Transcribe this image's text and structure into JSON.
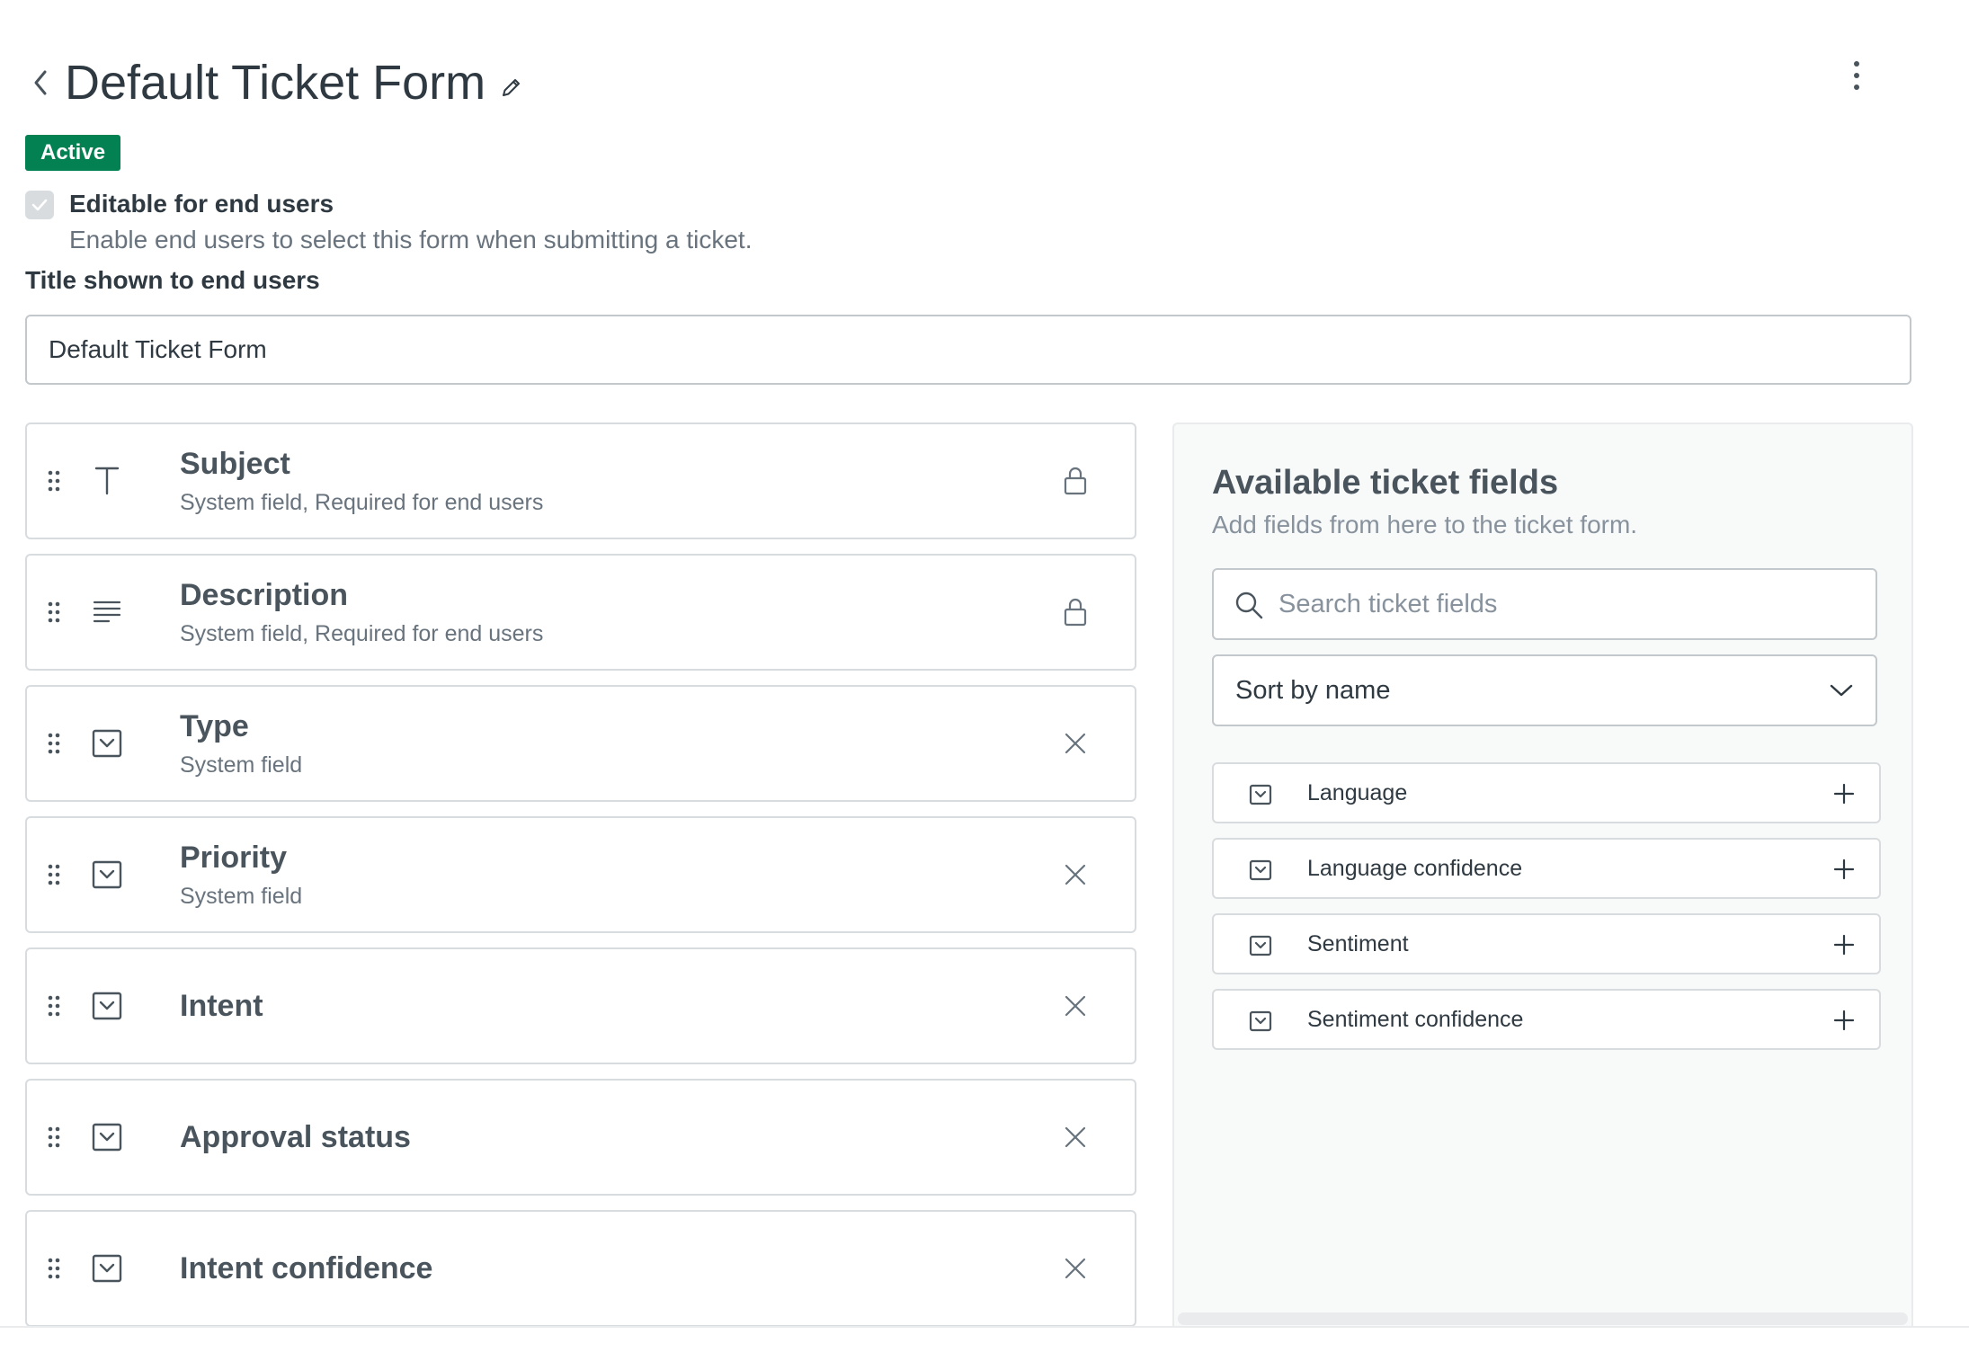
{
  "header": {
    "title": "Default Ticket Form",
    "back_icon": "chevron-left-icon",
    "edit_icon": "pencil-icon",
    "menu_icon": "kebab-menu-icon"
  },
  "status": {
    "label": "Active",
    "color": "#038153"
  },
  "editable": {
    "checked": true,
    "label": "Editable for end users",
    "hint": "Enable end users to select this form when submitting a ticket."
  },
  "title_field": {
    "label": "Title shown to end users",
    "value": "Default Ticket Form"
  },
  "form_fields": [
    {
      "name": "Subject",
      "description": "System field, Required for end users",
      "icon": "text-icon",
      "action": "lock-icon"
    },
    {
      "name": "Description",
      "description": "System field, Required for end users",
      "icon": "multiline-icon",
      "action": "lock-icon"
    },
    {
      "name": "Type",
      "description": "System field",
      "icon": "dropdown-icon",
      "action": "remove-icon"
    },
    {
      "name": "Priority",
      "description": "System field",
      "icon": "dropdown-icon",
      "action": "remove-icon"
    },
    {
      "name": "Intent",
      "description": "",
      "icon": "dropdown-icon",
      "action": "remove-icon"
    },
    {
      "name": "Approval status",
      "description": "",
      "icon": "dropdown-icon",
      "action": "remove-icon"
    },
    {
      "name": "Intent confidence",
      "description": "",
      "icon": "dropdown-icon",
      "action": "remove-icon"
    }
  ],
  "available": {
    "title": "Available ticket fields",
    "subtitle": "Add fields from here to the ticket form.",
    "search_placeholder": "Search ticket fields",
    "search_value": "",
    "sort_label": "Sort by name",
    "items": [
      {
        "label": "Language",
        "icon": "dropdown-icon"
      },
      {
        "label": "Language confidence",
        "icon": "dropdown-icon"
      },
      {
        "label": "Sentiment",
        "icon": "dropdown-icon"
      },
      {
        "label": "Sentiment confidence",
        "icon": "dropdown-icon"
      }
    ]
  }
}
